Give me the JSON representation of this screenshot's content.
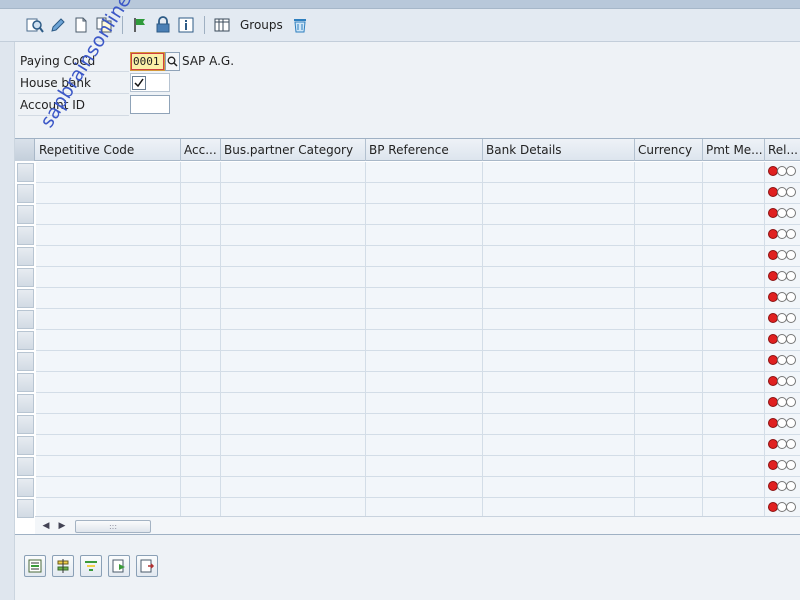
{
  "toolbar": {
    "icons": [
      "display-change-icon",
      "edit-pencil-icon",
      "new-document-icon",
      "copy-icon",
      "flag-icon",
      "lock-icon",
      "info-icon",
      "table-settings-icon",
      "delete-trash-icon"
    ],
    "groups_label": "Groups"
  },
  "form": {
    "paying_cocd_label": "Paying CoCd",
    "paying_cocd_value": "0001",
    "company_name": "SAP A.G.",
    "house_bank_label": "House bank",
    "house_bank_checked": true,
    "account_id_label": "Account ID",
    "account_id_value": ""
  },
  "table": {
    "columns": [
      {
        "label": "Repetitive Code"
      },
      {
        "label": "Acc..."
      },
      {
        "label": "Bus.partner Category"
      },
      {
        "label": "BP Reference"
      },
      {
        "label": "Bank Details"
      },
      {
        "label": "Currency"
      },
      {
        "label": "Pmt Me..."
      },
      {
        "label": "Rel..."
      }
    ],
    "row_count": 17,
    "status_lights": [
      "red",
      "off",
      "off"
    ]
  },
  "bottom_toolbar": {
    "icons": [
      "insert-row-icon",
      "align-icon",
      "filter-icon",
      "details-icon",
      "export-icon"
    ]
  },
  "watermark": "sapbrainsonline.com",
  "colors": {
    "accent": "#3b57c7",
    "status_red": "#e02020",
    "highlight_field": "#fbf0a8"
  }
}
